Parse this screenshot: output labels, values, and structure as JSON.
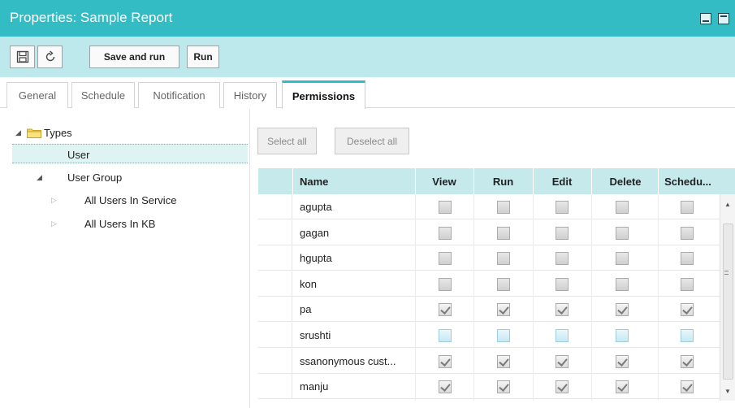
{
  "window": {
    "title": "Properties: Sample Report"
  },
  "toolbar": {
    "save_icon": "save-icon",
    "refresh_icon": "refresh-icon",
    "save_and_run_label": "Save and run",
    "run_label": "Run"
  },
  "tabs": [
    {
      "label": "General",
      "active": false
    },
    {
      "label": "Schedule",
      "active": false
    },
    {
      "label": "Notification",
      "active": false
    },
    {
      "label": "History",
      "active": false
    },
    {
      "label": "Permissions",
      "active": true
    }
  ],
  "tree": {
    "root": "Types",
    "user": "User",
    "user_group": "User Group",
    "groups": [
      "All Users In Service",
      "All Users In KB"
    ]
  },
  "actions": {
    "select_all": "Select all",
    "deselect_all": "Deselect all"
  },
  "grid": {
    "columns": [
      "Name",
      "View",
      "Run",
      "Edit",
      "Delete",
      "Schedu..."
    ],
    "rows": [
      {
        "name": "agupta",
        "state": "unchecked"
      },
      {
        "name": "gagan",
        "state": "unchecked"
      },
      {
        "name": "hgupta",
        "state": "unchecked"
      },
      {
        "name": "kon",
        "state": "unchecked"
      },
      {
        "name": "pa",
        "state": "checked"
      },
      {
        "name": "srushti",
        "state": "blue"
      },
      {
        "name": "ssanonymous cust...",
        "state": "checked"
      },
      {
        "name": "manju",
        "state": "checked"
      }
    ]
  },
  "colors": {
    "accent": "#33bcc4",
    "toolbar_bg": "#bde9ed",
    "header_bg": "#c6e9ec"
  }
}
